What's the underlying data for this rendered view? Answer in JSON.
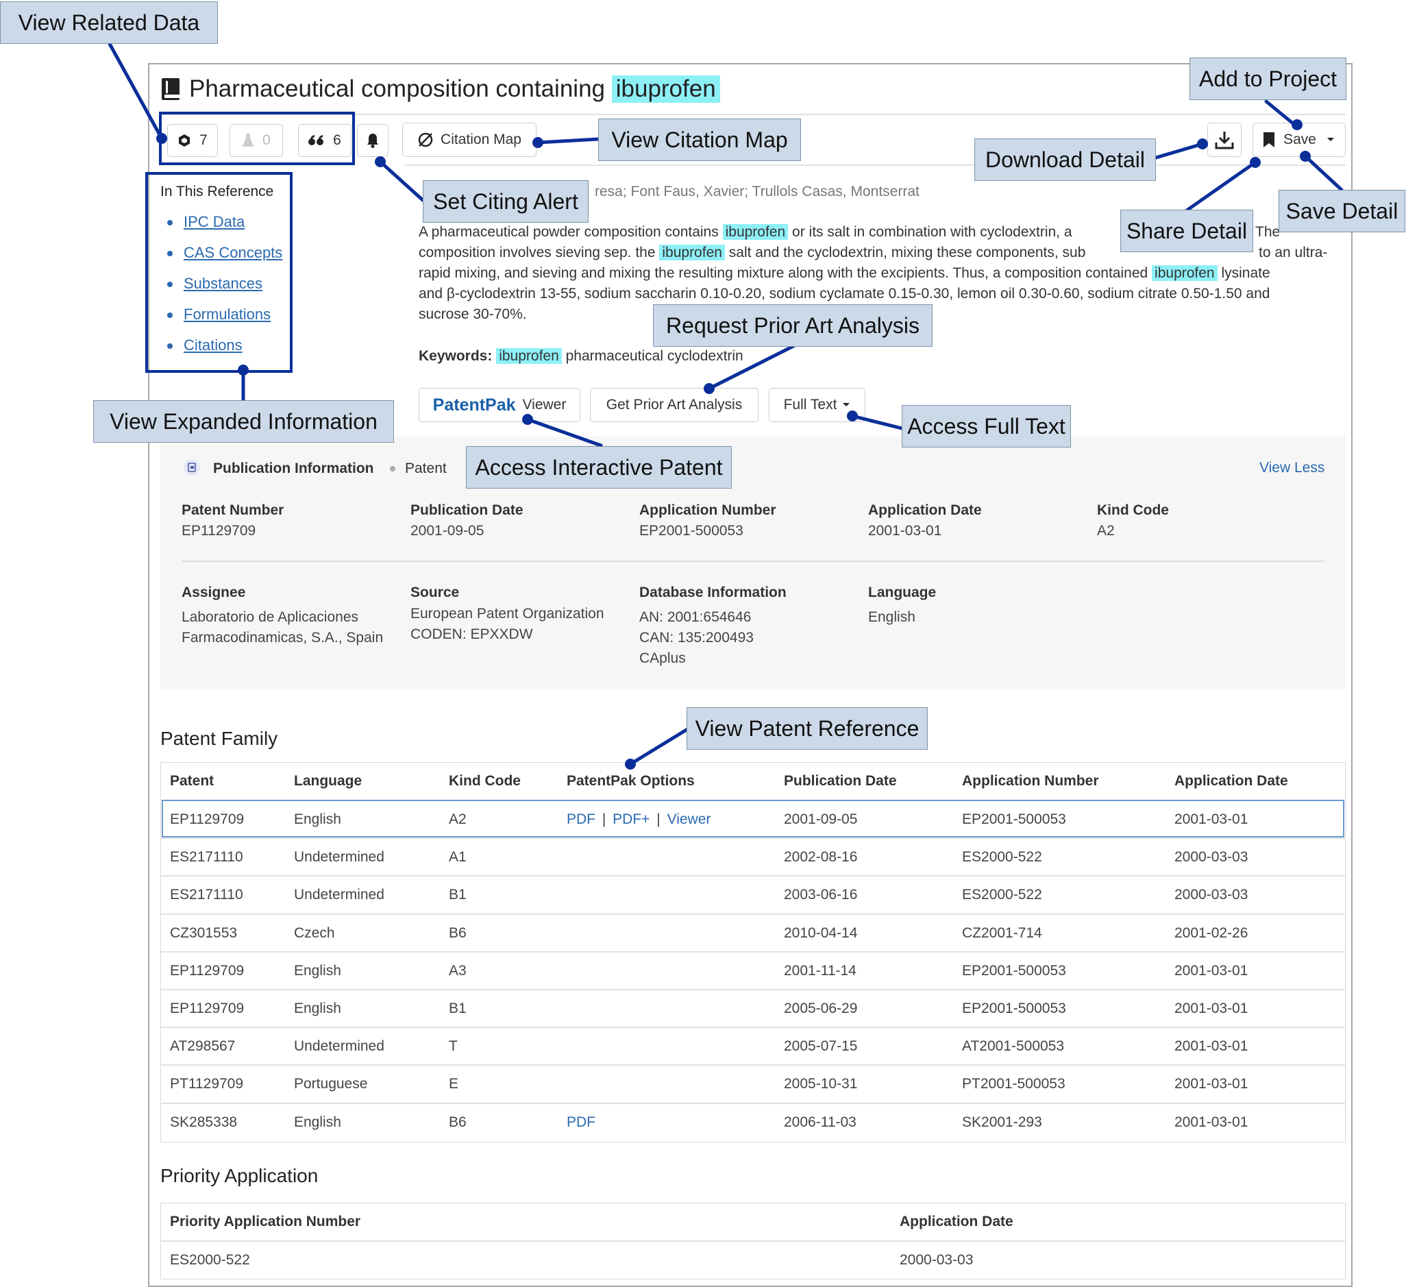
{
  "reference": {
    "title_prefix": "Pharmaceutical composition containing",
    "title_highlight": "ibuprofen",
    "related": {
      "substances": "7",
      "reactions": "0",
      "citations": "6"
    },
    "citation_map_label": "Citation Map",
    "save_label": "Save",
    "authors_fragment": "resa; Font Faus, Xavier; Trullols Casas, Montserrat"
  },
  "sidebar": {
    "heading": "In This Reference",
    "items": [
      "IPC Data",
      "CAS Concepts",
      "Substances",
      "Formulations",
      "Citations"
    ]
  },
  "abstract": {
    "line1_a": "A pharmaceutical powder composition contains",
    "line1_hl": "ibuprofen",
    "line1_b": "or its salt in combination with cyclodextrin, a",
    "line1_c": "The",
    "line2_a": "composition involves sieving sep. the",
    "line2_hl": "ibuprofen",
    "line2_b": "salt and the cyclodextrin, mixing these components, sub",
    "line2_c": "to an ultra-",
    "line3_a": "rapid mixing, and sieving and mixing the resulting mixture along with the excipients. Thus, a composition contained",
    "line3_hl": "ibuprofen",
    "line3_b": "lysinate",
    "line4": "and β-cyclodextrin 13-55, sodium saccharin 0.10-0.20, sodium cyclamate 0.15-0.30, lemon oil 0.30-0.60, sodium citrate 0.50-1.50 and",
    "line5": "sucrose 30-70%.",
    "keywords_label": "Keywords:",
    "keywords_hl": "ibuprofen",
    "keywords_rest": "pharmaceutical cyclodextrin"
  },
  "actions": {
    "patentpak_brand": "PatentPak",
    "patentpak_viewer": "Viewer",
    "prior_art": "Get Prior Art Analysis",
    "full_text": "Full Text"
  },
  "publication": {
    "heading": "Publication Information",
    "type": "Patent",
    "view_less": "View Less",
    "fields": {
      "patent_number": {
        "label": "Patent Number",
        "value": "EP1129709"
      },
      "publication_date": {
        "label": "Publication Date",
        "value": "2001-09-05"
      },
      "application_number": {
        "label": "Application Number",
        "value": "EP2001-500053"
      },
      "application_date": {
        "label": "Application Date",
        "value": "2001-03-01"
      },
      "kind_code": {
        "label": "Kind Code",
        "value": "A2"
      },
      "assignee": {
        "label": "Assignee",
        "line1": "Laboratorio de Aplicaciones",
        "line2": "Farmacodinamicas, S.A., Spain"
      },
      "source": {
        "label": "Source",
        "line1": "European Patent Organization",
        "line2": "CODEN: EPXXDW"
      },
      "database": {
        "label": "Database Information",
        "line1": "AN: 2001:654646",
        "line2": "CAN: 135:200493",
        "line3": "CAplus"
      },
      "language": {
        "label": "Language",
        "value": "English"
      }
    }
  },
  "patent_family": {
    "title": "Patent Family",
    "headers": [
      "Patent",
      "Language",
      "Kind Code",
      "PatentPak Options",
      "Publication Date",
      "Application Number",
      "Application Date"
    ],
    "rows": [
      [
        "EP1129709",
        "English",
        "A2",
        "",
        "2001-09-05",
        "EP2001-500053",
        "2001-03-01"
      ],
      [
        "ES2171110",
        "Undetermined",
        "A1",
        "",
        "2002-08-16",
        "ES2000-522",
        "2000-03-03"
      ],
      [
        "ES2171110",
        "Undetermined",
        "B1",
        "",
        "2003-06-16",
        "ES2000-522",
        "2000-03-03"
      ],
      [
        "CZ301553",
        "Czech",
        "B6",
        "",
        "2010-04-14",
        "CZ2001-714",
        "2001-02-26"
      ],
      [
        "EP1129709",
        "English",
        "A3",
        "",
        "2001-11-14",
        "EP2001-500053",
        "2001-03-01"
      ],
      [
        "EP1129709",
        "English",
        "B1",
        "",
        "2005-06-29",
        "EP2001-500053",
        "2001-03-01"
      ],
      [
        "AT298567",
        "Undetermined",
        "T",
        "",
        "2005-07-15",
        "AT2001-500053",
        "2001-03-01"
      ],
      [
        "PT1129709",
        "Portuguese",
        "E",
        "",
        "2005-10-31",
        "PT2001-500053",
        "2001-03-01"
      ],
      [
        "SK285338",
        "English",
        "B6",
        "",
        "2006-11-03",
        "SK2001-293",
        "2001-03-01"
      ]
    ],
    "options_row1": {
      "pdf": "PDF",
      "pdfplus": "PDF+",
      "viewer": "Viewer",
      "sep": "|"
    },
    "options_row9": {
      "pdf": "PDF"
    }
  },
  "priority": {
    "title": "Priority Application",
    "headers": [
      "Priority Application Number",
      "Application Date"
    ],
    "row": [
      "ES2000-522",
      "2000-03-03"
    ]
  },
  "callouts": {
    "view_related": "View Related Data",
    "add_project": "Add to Project",
    "citation_map": "View Citation Map",
    "download": "Download Detail",
    "citing_alert": "Set Citing Alert",
    "share": "Share Detail",
    "save": "Save Detail",
    "prior_art": "Request Prior Art Analysis",
    "expanded": "View Expanded Information",
    "full_text": "Access Full Text",
    "interactive": "Access Interactive Patent",
    "patent_ref": "View Patent Reference"
  },
  "colors": {
    "highlight": "#8ef0f7",
    "link": "#2a6ab0",
    "callout_bg": "#cbd9e8",
    "callout_line": "#0b2f9a"
  }
}
